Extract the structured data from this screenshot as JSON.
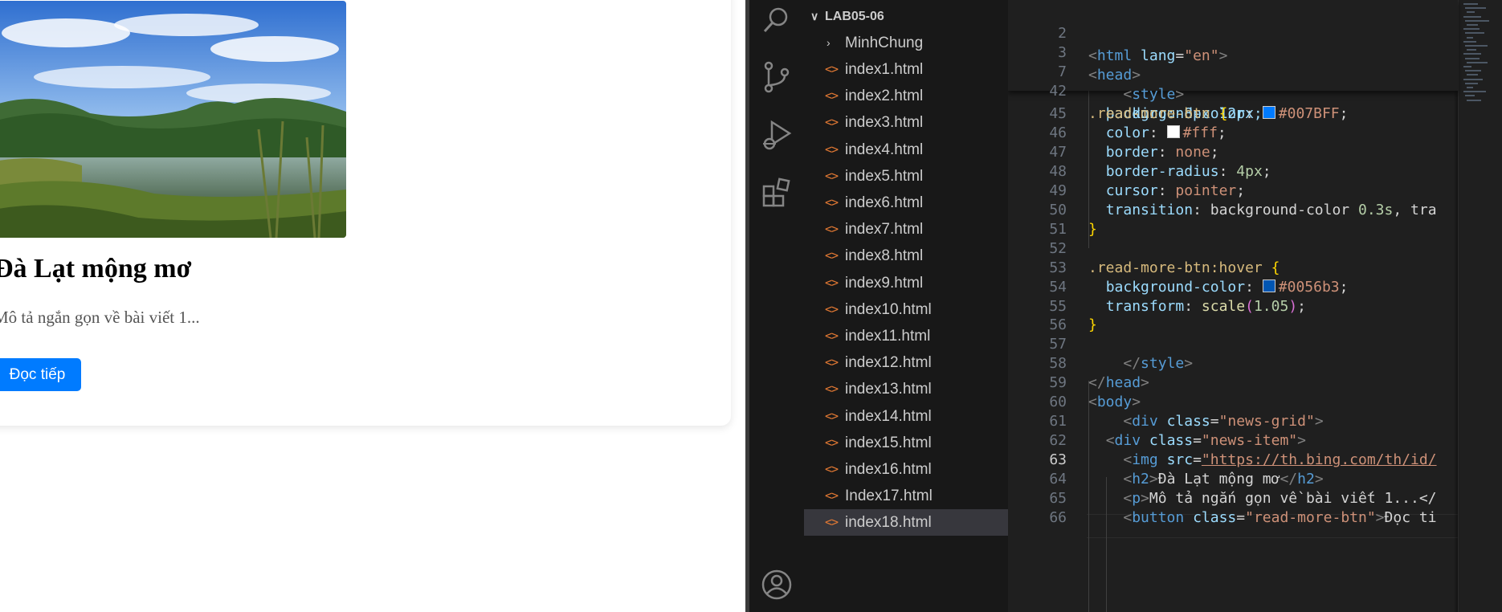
{
  "browser": {
    "card": {
      "image_icon": "landscape-photo",
      "title": "Đà Lạt mộng mơ",
      "description": "Mô tả ngắn gọn về bài viết 1...",
      "button_label": "Đọc tiếp",
      "button_color": "#007BFF"
    }
  },
  "vscode": {
    "activity_bar": [
      "search-icon",
      "source-control-icon",
      "run-debug-icon",
      "extensions-icon",
      "account-icon"
    ],
    "explorer": {
      "root": "LAB05-06",
      "folder": "MinhChung",
      "files": [
        "index1.html",
        "index2.html",
        "index3.html",
        "index4.html",
        "index5.html",
        "index6.html",
        "index7.html",
        "index8.html",
        "index9.html",
        "index10.html",
        "index11.html",
        "index12.html",
        "index13.html",
        "index14.html",
        "index15.html",
        "index16.html",
        "Index17.html",
        "index18.html"
      ],
      "selected": "index18.html",
      "file_icon": "<>"
    },
    "sticky_scroll": {
      "lines": [
        {
          "num": "2",
          "text": "<html lang=\"en\">"
        },
        {
          "num": "3",
          "text": "<head>"
        },
        {
          "num": "7",
          "text": "<style>"
        },
        {
          "num": "42",
          "text": ".read-more-btn {"
        }
      ]
    },
    "code": {
      "current_line": "63",
      "partial_top": "padding: 8px 12px;",
      "line_numbers": [
        "45",
        "46",
        "47",
        "48",
        "49",
        "50",
        "51",
        "52",
        "53",
        "54",
        "55",
        "56",
        "57",
        "58",
        "59",
        "60",
        "61",
        "62",
        "63",
        "64",
        "65",
        "66"
      ],
      "l45": {
        "prop": "background-color",
        "value": "#007BFF",
        "swatch": "#007BFF"
      },
      "l46": {
        "prop": "color",
        "value": "#fff",
        "swatch": "#ffffff"
      },
      "l47": {
        "prop": "border",
        "value": "none"
      },
      "l48": {
        "prop": "border-radius",
        "value": "4px"
      },
      "l49": {
        "prop": "cursor",
        "value": "pointer"
      },
      "l50": {
        "prop": "transition",
        "value1": "background-color",
        "value2": "0.3s",
        "rest": ", tra"
      },
      "l51": "}",
      "l53": {
        "selector": ".read-more-btn:hover",
        "brace": "{"
      },
      "l54": {
        "prop": "background-color",
        "value": "#0056b3",
        "swatch": "#0056b3"
      },
      "l55": {
        "prop": "transform",
        "fn": "scale",
        "arg": "1.05"
      },
      "l56": "}",
      "l58": "style",
      "l59": "head",
      "l60": "body",
      "l61": {
        "tag": "div",
        "attr": "class",
        "value": "\"news-grid\""
      },
      "l62": {
        "tag": "div",
        "attr": "class",
        "value": "\"news-item\""
      },
      "l63": {
        "tag": "img",
        "attr": "src",
        "value": "\"https://th.bing.com/th/id/"
      },
      "l64": {
        "tag": "h2",
        "text": "Đà Lạt mộng mơ"
      },
      "l65": {
        "tag": "p",
        "text": "Mô tả ngắn gọn về bài viết 1...</"
      },
      "l66": {
        "tag": "button",
        "attr": "class",
        "value": "\"read-more-btn\"",
        "text": "Đọc ti"
      }
    }
  }
}
